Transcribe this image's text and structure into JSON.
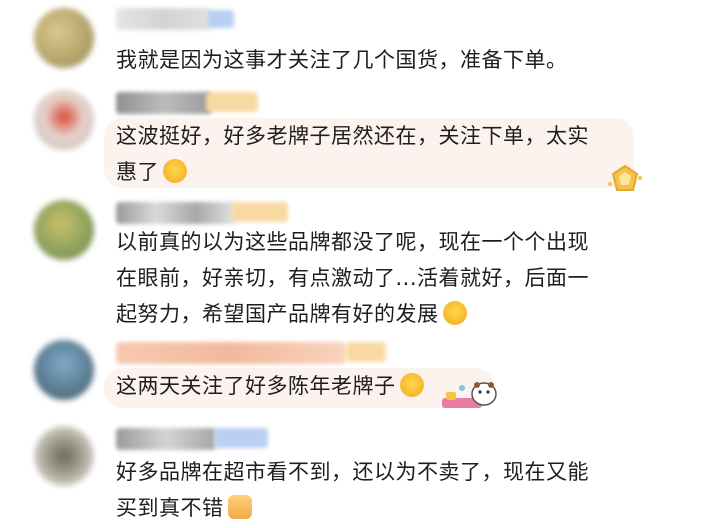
{
  "comments": [
    {
      "text": "我就是因为这事才关注了几个国货，准备下单。"
    },
    {
      "text_line1": "这波挺好，好多老牌子居然还在，关注下单，太实",
      "text_line2": "惠了"
    },
    {
      "text_line1": "以前真的以为这些品牌都没了呢，现在一个个出现",
      "text_line2": "在眼前，好亲切，有点激动了...活着就好，后面一",
      "text_line3": "起努力，希望国产品牌有好的发展"
    },
    {
      "text": "这两天关注了好多陈年老牌子"
    },
    {
      "text_line1": "好多品牌在超市看不到，还以为不卖了，现在又能",
      "text_line2": "买到真不错"
    }
  ],
  "icons": [
    "laughing-crying-emoji",
    "crying-emoji",
    "laughing-crying-emoji",
    "thumbs-up-emoji",
    "crown-badge-sticker",
    "animal-sticker"
  ],
  "colors": {
    "background": "#ffffff",
    "bubble": "#fdf3ee",
    "text": "#1e1e1e",
    "username_blur": "#c9d3e4",
    "badge_blur": "#f6d7a8"
  }
}
